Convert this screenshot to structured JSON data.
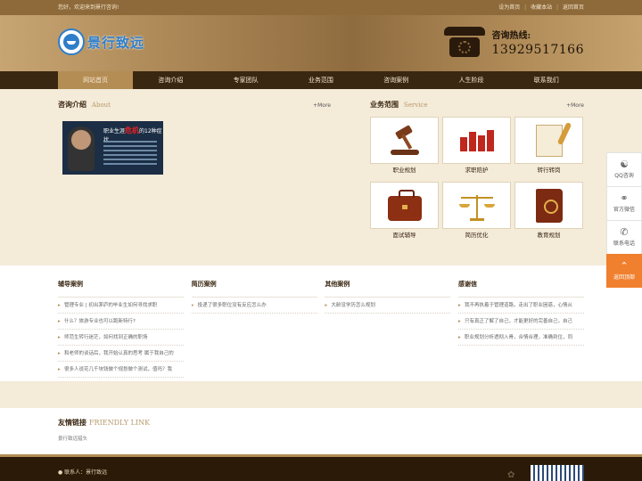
{
  "topbar": {
    "welcome": "您好，欢迎来到景行咨询!",
    "links": [
      "设为首页",
      "收藏本站",
      "返回首页"
    ]
  },
  "header": {
    "logo_text": "景行致远",
    "hotline_label": "咨询热线:",
    "hotline_number": "13929517166"
  },
  "nav": {
    "items": [
      "网站首页",
      "咨询介绍",
      "专家团队",
      "业务范围",
      "咨询案例",
      "人生阶段",
      "联系我们"
    ],
    "active_index": 0
  },
  "about": {
    "title": "咨询介绍",
    "subtitle": "About",
    "more": "+More",
    "image_text_a": "职业生涯",
    "image_text_b": "危机",
    "image_text_c": "的12种症状"
  },
  "service": {
    "title": "业务范围",
    "subtitle": "Service",
    "more": "+More",
    "items": [
      {
        "label": "职业规划",
        "icon": "gavel-icon"
      },
      {
        "label": "求职陪护",
        "icon": "bar-chart-icon"
      },
      {
        "label": "转行转岗",
        "icon": "quill-pen-icon"
      },
      {
        "label": "面试辅导",
        "icon": "briefcase-icon"
      },
      {
        "label": "简历优化",
        "icon": "scale-icon"
      },
      {
        "label": "教育规划",
        "icon": "book-icon"
      }
    ]
  },
  "cases": [
    {
      "title": "辅导案例",
      "items": [
        "管理专业 | 初出茅庐的毕业生如何寻找求职",
        "什么？旅游专业也可以跑新特行?",
        "师范生转行迷茫，如何找到正确的职场",
        "和老师的谈话后，我开始认真的思考 属于我自己的",
        "很多人说花几千块钱做个规划做个测试，值吗？我"
      ]
    },
    {
      "title": "简历案例",
      "items": [
        "投递了很多职位没有反应怎么办"
      ]
    },
    {
      "title": "其他案例",
      "items": [
        "大龄没学历怎么规划"
      ]
    },
    {
      "title": "感谢信",
      "items": [
        "我不再执着于管理道路，走出了职业困惑，心情从",
        "只有真正了解了自己，才能更好的完善自己，自己",
        "职业规划分析透彻入骨，合情合理，准确到位，同"
      ]
    }
  ],
  "links": {
    "title": "友情链接",
    "subtitle": "FRIENDLY LINK",
    "items": [
      "景行致远猎头"
    ]
  },
  "footer": {
    "contact": "联系人：景行致远"
  },
  "float": {
    "items": [
      {
        "label": "QQ咨询",
        "icon": "qq-icon"
      },
      {
        "label": "官方微信",
        "icon": "wechat-icon"
      },
      {
        "label": "联系电话",
        "icon": "phone-icon"
      },
      {
        "label": "返回顶部",
        "icon": "arrow-up-icon"
      }
    ]
  }
}
